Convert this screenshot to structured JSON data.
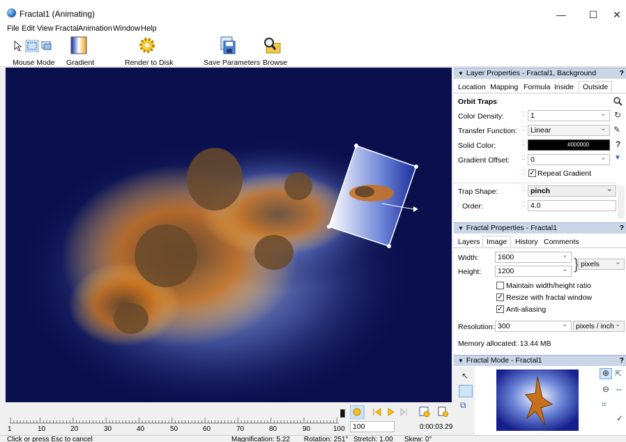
{
  "window": {
    "title": "Fractal1 (Animating)",
    "controls": {
      "minimize": "—",
      "maximize": "☐",
      "close": "✕"
    }
  },
  "menu": [
    "File",
    "Edit",
    "View",
    "Fractal",
    "Animation",
    "Window",
    "Help"
  ],
  "toolbar": {
    "mouse_mode": "Mouse Mode",
    "gradient": "Gradient",
    "render": "Render to Disk",
    "save_params": "Save Parameters",
    "browse": "Browse"
  },
  "timeline": {
    "ticks": [
      "1",
      "10",
      "20",
      "30",
      "40",
      "50",
      "60",
      "70",
      "80",
      "90",
      "100"
    ],
    "frame_value": "100",
    "time": "0:00:03.29"
  },
  "status": {
    "hint": "Click or press Esc to cancel",
    "magnification": "Magnification: 5.22",
    "rotation": "Rotation: 251°",
    "stretch": "Stretch: 1.00",
    "skew": "Skew: 0°"
  },
  "layer_props": {
    "header": "Layer Properties - Fractal1, Background",
    "help": "?",
    "tabs": [
      "Location",
      "Mapping",
      "Formula",
      "Inside",
      "Outside"
    ],
    "active_tab": "Outside",
    "section": "Orbit Traps",
    "color_density_label": "Color Density:",
    "color_density": "1",
    "transfer_label": "Transfer Function:",
    "transfer": "Linear",
    "solid_color_label": "Solid Color:",
    "solid_color": "#000000",
    "gradient_offset_label": "Gradient Offset:",
    "gradient_offset": "0",
    "repeat_gradient": "Repeat Gradient",
    "trap_shape_label": "Trap Shape:",
    "trap_shape": "pinch",
    "order_label": "Order:",
    "order": "4.0"
  },
  "fractal_props": {
    "header": "Fractal Properties - Fractal1",
    "help": "?",
    "tabs": [
      "Layers",
      "Image",
      "History",
      "Comments"
    ],
    "active_tab": "Image",
    "width_label": "Width:",
    "width": "1600",
    "height_label": "Height:",
    "height": "1200",
    "units": "pixels",
    "maintain_ratio": "Maintain width/height ratio",
    "resize_with_window": "Resize with fractal window",
    "anti_aliasing": "Anti-aliasing",
    "resolution_label": "Resolution:",
    "resolution": "300",
    "res_units": "pixels / inch",
    "memory": "Memory allocated:   13.44 MB"
  },
  "fractal_mode": {
    "header": "Fractal Mode - Fractal1",
    "help": "?"
  }
}
